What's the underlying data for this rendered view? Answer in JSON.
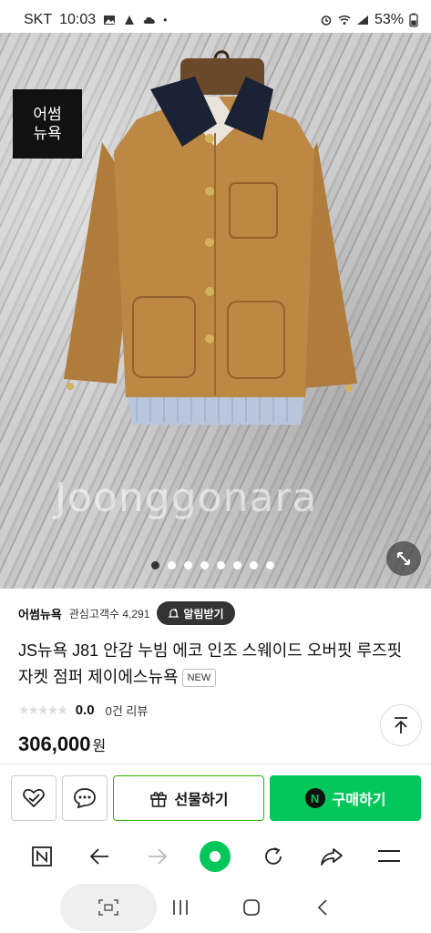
{
  "status_bar": {
    "carrier": "SKT",
    "time": "10:03",
    "battery": "53%",
    "icons": [
      "image-icon",
      "app-icon",
      "cloud-icon",
      "dot-icon",
      "alarm-icon",
      "wifi-icon",
      "signal-icon",
      "battery-icon"
    ]
  },
  "product_image": {
    "brand_badge_line1": "어썸",
    "brand_badge_line2": "뉴욕",
    "watermark": "Joonggonara",
    "carousel_count": 8,
    "carousel_active": 0
  },
  "seller": {
    "name": "어썸뉴욕",
    "followers_label": "관심고객수 4,291",
    "alarm_button": "알림받기"
  },
  "product": {
    "title": "JS뉴욕 J81 안감 누빔 에코 인조 스웨이드 오버핏 루즈핏 자켓 점퍼 제이에스뉴욕",
    "tag": "NEW",
    "rating": "0.0",
    "review_count": "0건 리뷰",
    "price": "306,000",
    "currency": "원"
  },
  "purchase_bar": {
    "gift_label": "선물하기",
    "buy_label": "구매하기",
    "buy_logo": "N"
  },
  "browser_bar": {
    "icons": [
      "naver-tab-icon",
      "back-arrow-icon",
      "forward-arrow-icon",
      "home-icon",
      "refresh-icon",
      "share-icon",
      "menu-icon"
    ]
  },
  "system_nav": {
    "icons": [
      "capture-icon",
      "recents-icon",
      "home-icon",
      "back-icon"
    ]
  },
  "colors": {
    "accent_green": "#03c75a",
    "gift_border": "#2db400",
    "price_red": "#e0262b"
  }
}
